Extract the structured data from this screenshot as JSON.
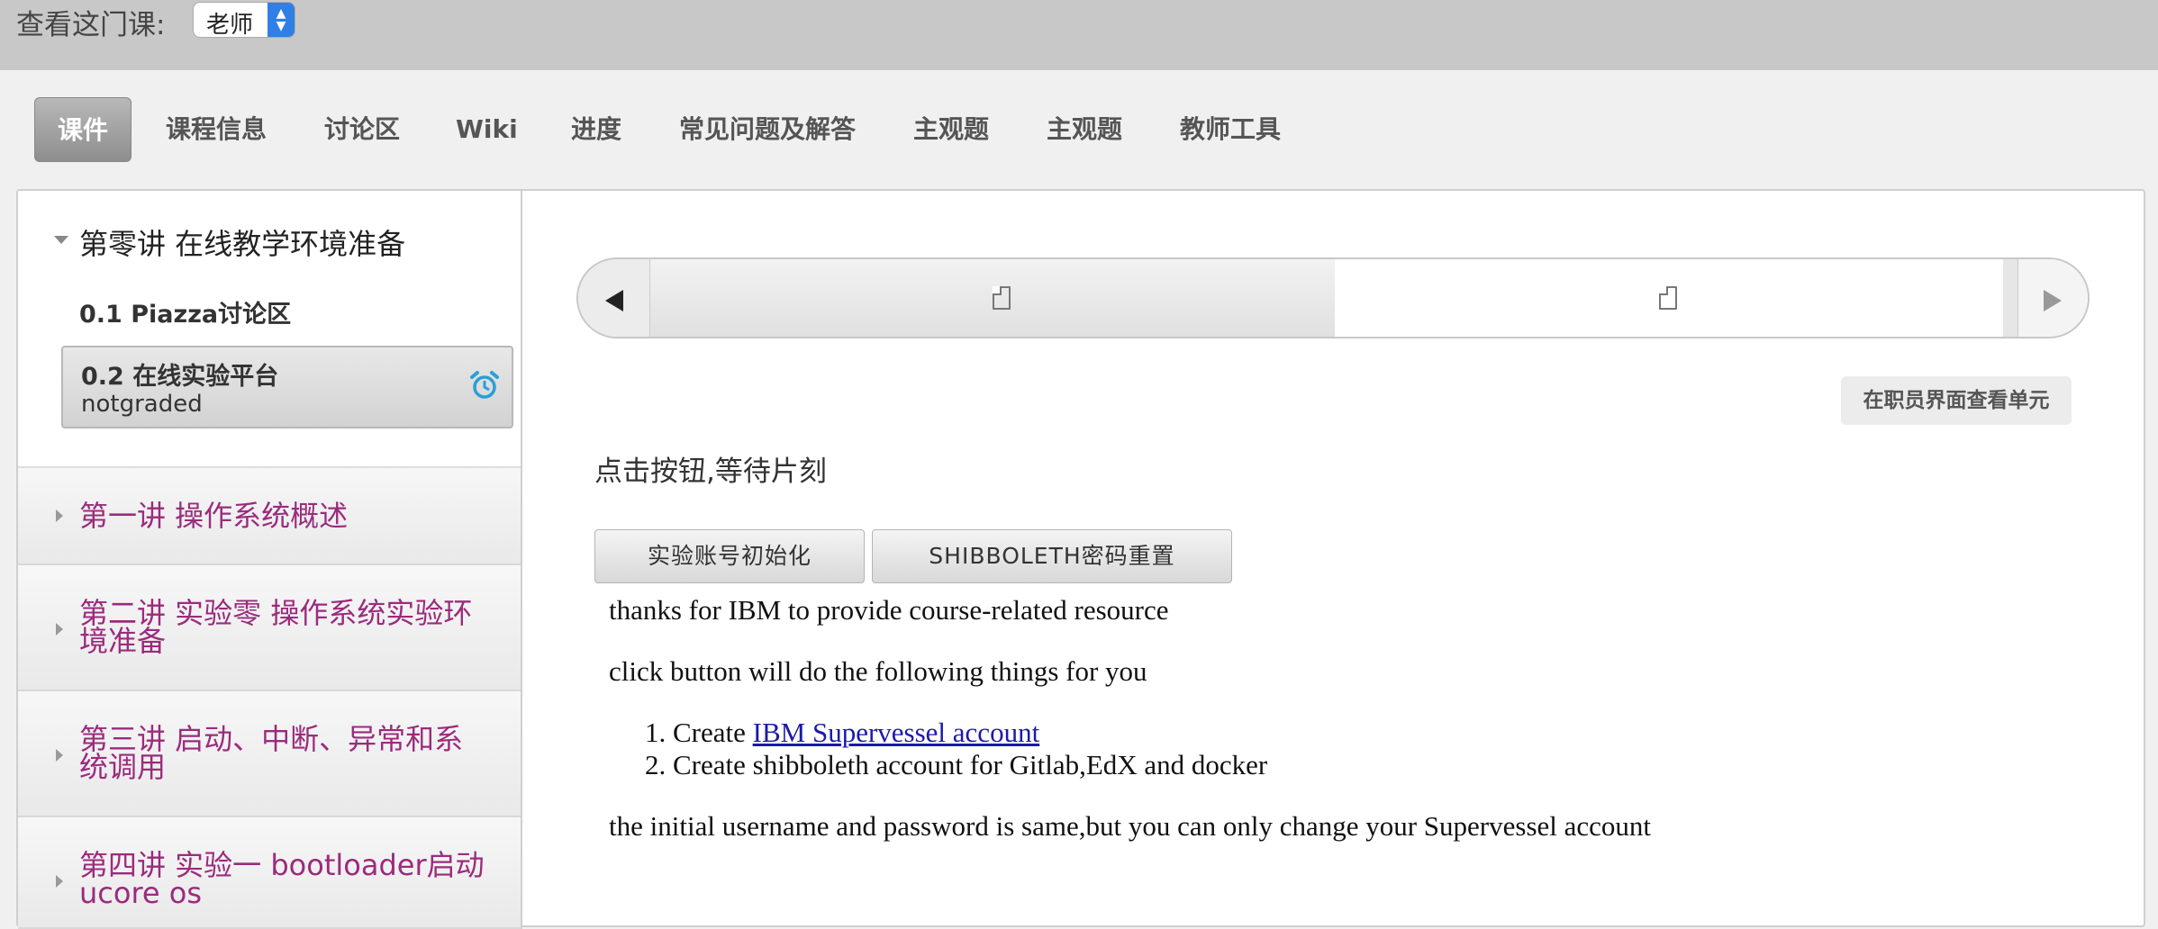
{
  "topbar": {
    "label": "查看这门课:",
    "role_selected": "老师"
  },
  "tabs": [
    {
      "label": "课件",
      "active": true
    },
    {
      "label": "课程信息",
      "active": false
    },
    {
      "label": "讨论区",
      "active": false
    },
    {
      "label": "Wiki",
      "active": false
    },
    {
      "label": "进度",
      "active": false
    },
    {
      "label": "常见问题及解答",
      "active": false
    },
    {
      "label": "主观题",
      "active": false
    },
    {
      "label": "主观题",
      "active": false
    },
    {
      "label": "教师工具",
      "active": false
    }
  ],
  "sidebar": {
    "open_chapter": {
      "title": "第零讲 在线教学环境准备",
      "sections": [
        {
          "title": "0.1 Piazza讨论区"
        },
        {
          "title": "0.2 在线实验平台",
          "subtitle": "notgraded",
          "icon": "alarm-clock-icon"
        }
      ]
    },
    "chapters": [
      {
        "line1": "第一讲 操作系统概述",
        "line2": ""
      },
      {
        "line1": "第二讲 实验零 操作系统实验环",
        "line2": "境准备"
      },
      {
        "line1": "第三讲 启动、中断、异常和系",
        "line2": "统调用"
      },
      {
        "line1": "第四讲 实验一 bootloader启动",
        "line2": "ucore os"
      }
    ]
  },
  "main": {
    "staff_view_button": "在职员界面查看单元",
    "hint": "点击按钮,等待片刻",
    "buttons": [
      "实验账号初始化",
      "SHIBBOLETH密码重置"
    ],
    "content": {
      "p1": "thanks for IBM to provide course-related resource",
      "p2": "click button will do the following things for you",
      "list": [
        {
          "num": "1.",
          "prefix": "Create ",
          "link": "IBM Supervessel account",
          "rest": ""
        },
        {
          "num": "2.",
          "prefix": "Create shibboleth account for Gitlab,EdX and docker",
          "link": "",
          "rest": ""
        }
      ],
      "p3": "the initial username and password is same,but you can only change your Supervessel account"
    }
  },
  "colors": {
    "chapter_link": "#9b2b7d",
    "link": "#1a1aa8",
    "alarm_icon": "#2a9fd6",
    "select_arrows": "#2f7fe6"
  }
}
